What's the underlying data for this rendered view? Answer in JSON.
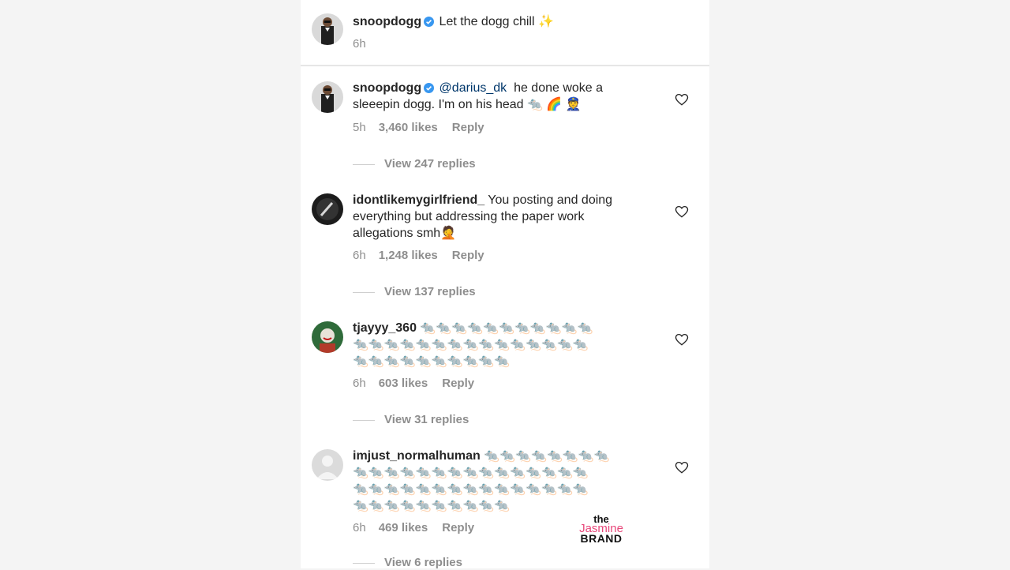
{
  "caption": {
    "username": "snoopdogg",
    "text": "Let the dogg chill",
    "emoji": "✨",
    "time": "6h"
  },
  "comments": [
    {
      "username": "snoopdogg",
      "mention": "@darius_dk",
      "line1_text": "he done woke a",
      "line2_text": "sleeepin dogg. I'm on his head 🐀 🌈 👮",
      "time": "5h",
      "likes": "3,460 likes",
      "reply": "Reply",
      "view_replies": "View 247 replies"
    },
    {
      "username": "idontlikemygirlfriend_",
      "line1_text": "You posting and doing",
      "line2_text": "everything but addressing the paper work",
      "line3_text": "allegations smh🤦",
      "time": "6h",
      "likes": "1,248 likes",
      "reply": "Reply",
      "view_replies": "View 137 replies"
    },
    {
      "username": "tjayyy_360",
      "line1_text": "🐀🐀🐀🐀🐀🐀🐀🐀🐀🐀🐀",
      "line2_text": "🐀🐀🐀🐀🐀🐀🐀🐀🐀🐀🐀🐀🐀🐀🐀",
      "line3_text": "🐀🐀🐀🐀🐀🐀🐀🐀🐀🐀",
      "time": "6h",
      "likes": "603 likes",
      "reply": "Reply",
      "view_replies": "View 31 replies"
    },
    {
      "username": "imjust_normalhuman",
      "line1_text": "🐀🐀🐀🐀🐀🐀🐀🐀",
      "line2_text": "🐀🐀🐀🐀🐀🐀🐀🐀🐀🐀🐀🐀🐀🐀🐀",
      "line3_text": "🐀🐀🐀🐀🐀🐀🐀🐀🐀🐀🐀🐀🐀🐀🐀",
      "line4_text": "🐀🐀🐀🐀🐀🐀🐀🐀🐀🐀",
      "time": "6h",
      "likes": "469 likes",
      "reply": "Reply",
      "view_replies": "View 6 replies"
    }
  ],
  "watermark": {
    "the": "the",
    "jasmine": "Jasmine",
    "brand": "BRAND"
  },
  "colors": {
    "verified": "#3897f0",
    "mention": "#00376b",
    "meta": "#8e8e8e",
    "watermark_pink": "#e8477a"
  }
}
